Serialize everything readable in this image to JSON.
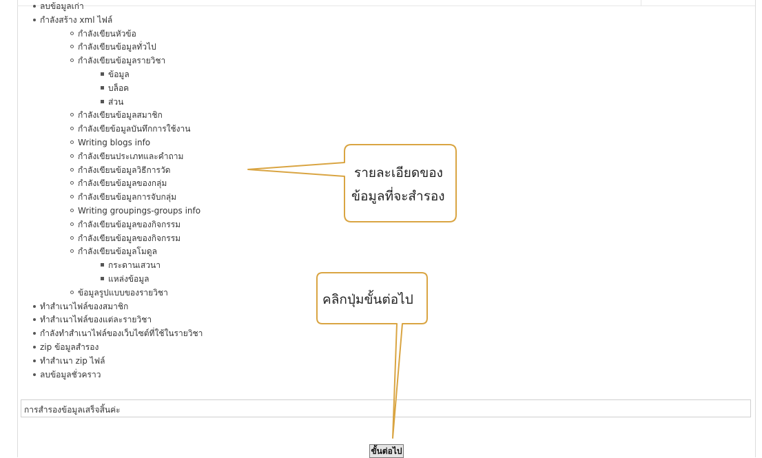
{
  "tree": [
    {
      "level": 1,
      "text": "ลบข้อมูลเก่า"
    },
    {
      "level": 1,
      "text": "กำลังสร้าง xml ไฟล์"
    },
    {
      "level": 2,
      "text": "กำลังเขียนหัวข้อ"
    },
    {
      "level": 2,
      "text": "กำลังเขียนข้อมูลทั่วไป"
    },
    {
      "level": 2,
      "text": "กำลังเขียนข้อมูลรายวิชา"
    },
    {
      "level": 3,
      "text": "ข้อมูล"
    },
    {
      "level": 3,
      "text": "บล็อค"
    },
    {
      "level": 3,
      "text": "ส่วน"
    },
    {
      "level": 2,
      "text": "กำลังเขียนข้อมูลสมาชิก"
    },
    {
      "level": 2,
      "text": "กำลังเขียข้อมูลบันทึกการใช้งาน"
    },
    {
      "level": 2,
      "text": "Writing blogs info"
    },
    {
      "level": 2,
      "text": "กำลังเขียนประเภทและคำถาม"
    },
    {
      "level": 2,
      "text": "กำลังเขียนข้อมูลวิธีการวัด"
    },
    {
      "level": 2,
      "text": "กำลังเขียนข้อมูลของกลุ่ม"
    },
    {
      "level": 2,
      "text": "กำลังเขียนข้อมูลการจับกลุ่ม"
    },
    {
      "level": 2,
      "text": "Writing groupings-groups info"
    },
    {
      "level": 2,
      "text": "กำลังเขียนข้อมูลของกิจกรรม"
    },
    {
      "level": 2,
      "text": "กำลังเขียนข้อมูลของกิจกรรม"
    },
    {
      "level": 2,
      "text": "กำลังเขียนข้อมูลโมดูล"
    },
    {
      "level": 3,
      "text": "กระดานเสวนา"
    },
    {
      "level": 3,
      "text": "แหล่งข้อมูล"
    },
    {
      "level": 2,
      "text": "ข้อมูลรูปแบบของรายวิชา"
    },
    {
      "level": 1,
      "text": "ทำสำเนาไฟล์ของสมาชิก"
    },
    {
      "level": 1,
      "text": "ทำสำเนาไฟล์ของแต่ละรายวิชา"
    },
    {
      "level": 1,
      "text": "กำลังทำสำเนาไฟล์ของเว็บไซต์ที่ใช้ในรายวิชา"
    },
    {
      "level": 1,
      "text": "zip ข้อมูลสำรอง"
    },
    {
      "level": 1,
      "text": "ทำสำเนา zip ไฟล์"
    },
    {
      "level": 1,
      "text": "ลบข้อมูลชั่วคราว"
    }
  ],
  "status": {
    "message": "การสำรองข้อมูลเสร็จสิ้นค่ะ"
  },
  "next_button": {
    "label": "ขั้นต่อไป"
  },
  "callouts": {
    "details": {
      "line1": "รายละเอียดของ",
      "line2": "ข้อมูลที่จะสำรอง"
    },
    "click": {
      "text": "คลิกปุ่มขั้นต่อไป"
    },
    "border_color": "#d9a441"
  }
}
